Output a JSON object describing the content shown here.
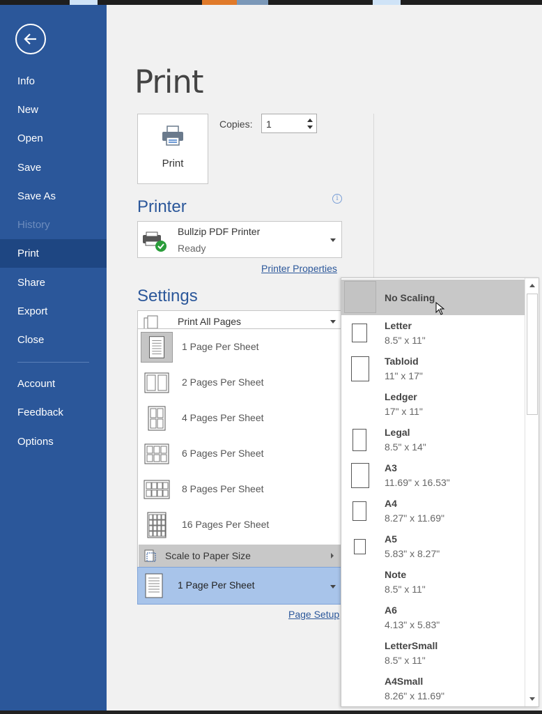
{
  "colors": {
    "sidebar": "#2b579a",
    "sidebar_active": "#1e4682",
    "accent": "#2b579a",
    "selected_blue": "#a8c4ea"
  },
  "sidebar": {
    "back_icon": "back-arrow-icon",
    "items": [
      {
        "label": "Info"
      },
      {
        "label": "New"
      },
      {
        "label": "Open"
      },
      {
        "label": "Save"
      },
      {
        "label": "Save As"
      },
      {
        "label": "History",
        "disabled": true
      },
      {
        "label": "Print",
        "active": true
      },
      {
        "label": "Share"
      },
      {
        "label": "Export"
      },
      {
        "label": "Close"
      },
      {
        "label": "Account"
      },
      {
        "label": "Feedback"
      },
      {
        "label": "Options"
      }
    ]
  },
  "page": {
    "title": "Print"
  },
  "print_button": {
    "label": "Print",
    "icon": "printer-icon"
  },
  "copies": {
    "label": "Copies:",
    "value": "1"
  },
  "printer": {
    "heading": "Printer",
    "name": "Bullzip PDF Printer",
    "status": "Ready",
    "properties_link": "Printer Properties",
    "info_icon": "i"
  },
  "settings": {
    "heading": "Settings",
    "print_range": "Print All Pages",
    "pages_per_sheet_options": [
      {
        "label": "1 Page Per Sheet",
        "selected": true
      },
      {
        "label": "2 Pages Per Sheet"
      },
      {
        "label": "4 Pages Per Sheet"
      },
      {
        "label": "6 Pages Per Sheet"
      },
      {
        "label": "8 Pages Per Sheet"
      },
      {
        "label": "16 Pages Per Sheet"
      }
    ],
    "scale_to_paper_size": "Scale to Paper Size",
    "pages_per_sheet_current": "1 Page Per Sheet",
    "page_setup_link": "Page Setup"
  },
  "paper_sizes": [
    {
      "name": "No Scaling",
      "size": "",
      "selected": true
    },
    {
      "name": "Letter",
      "size": "8.5\" x 11\""
    },
    {
      "name": "Tabloid",
      "size": "11\" x 17\""
    },
    {
      "name": "Ledger",
      "size": "17\" x 11\""
    },
    {
      "name": "Legal",
      "size": "8.5\" x 14\""
    },
    {
      "name": "A3",
      "size": "11.69\" x 16.53\""
    },
    {
      "name": "A4",
      "size": "8.27\" x 11.69\""
    },
    {
      "name": "A5",
      "size": "5.83\" x 8.27\""
    },
    {
      "name": "Note",
      "size": "8.5\" x 11\""
    },
    {
      "name": "A6",
      "size": "4.13\" x 5.83\""
    },
    {
      "name": "LetterSmall",
      "size": "8.5\" x 11\""
    },
    {
      "name": "A4Small",
      "size": "8.26\" x 11.69\""
    }
  ]
}
